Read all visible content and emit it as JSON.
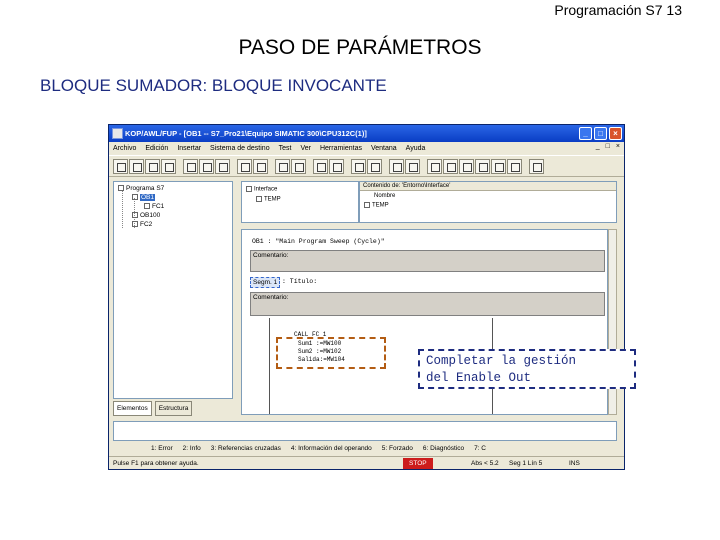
{
  "slide": {
    "page_number": "Programación S7  13",
    "title": "PASO DE PARÁMETROS",
    "subtitle": "BLOQUE SUMADOR: BLOQUE INVOCANTE",
    "callout_line1": "Completar la gestión",
    "callout_line2": "del Enable Out"
  },
  "window": {
    "title": "KOP/AWL/FUP  - [OB1 -- S7_Pro21\\Equipo SIMATIC 300\\CPU312C(1)]",
    "controls": {
      "minimize": "_",
      "maximize": "□",
      "close": "×"
    },
    "menu": [
      "Archivo",
      "Edición",
      "Insertar",
      "Sistema de destino",
      "Test",
      "Ver",
      "Herramientas",
      "Ventana",
      "Ayuda"
    ],
    "menu_doc_controls": [
      "_",
      "□",
      "×"
    ]
  },
  "tree": {
    "items": [
      "Programa S7",
      "OB1",
      "FC1",
      "OB100",
      "FC2"
    ],
    "tabs": [
      "Elementos",
      "Estructura"
    ]
  },
  "interface": {
    "left_items": [
      "Interface",
      "TEMP"
    ],
    "right_header": "Contenido de: 'Entorno\\Interface'",
    "right_col": "Nombre",
    "right_items": [
      "TEMP"
    ]
  },
  "code": {
    "block_title": "OB1 :  \"Main Program Sweep (Cycle)\"",
    "comment_label": "Comentario:",
    "segment_label": "Segm. 1",
    "segment_title": ": Título:",
    "segment_comment": "Comentario:",
    "fc_call": "CALL  FC   1",
    "params": [
      "Sum1  :=MW100",
      "Sum2  :=MW102",
      "Salida:=MW104"
    ]
  },
  "bottom": {
    "msg_tabs": [
      "1: Error",
      "2: Info",
      "3: Referencias cruzadas",
      "4: Información del operando",
      "5: Forzado",
      "6: Diagnóstico",
      "7: C"
    ],
    "status_help": "Pulse F1 para obtener ayuda.",
    "status_stop": "STOP",
    "status_abs": "Abs < 5.2",
    "status_seg": "Seg 1 Lín 5",
    "status_ins": "INS"
  }
}
